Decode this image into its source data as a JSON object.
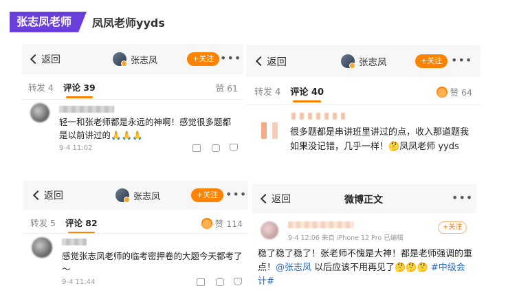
{
  "header": {
    "badge": "张志凤老师",
    "title": "凤凤老师yyds"
  },
  "common": {
    "back": "返回",
    "author": "张志凤",
    "follow": "+关注",
    "more": "•••"
  },
  "card1": {
    "reposts": "转发 4",
    "comments": "评论 39",
    "likes": "赞 61",
    "comment_text": "轻一和张老师都是永远的神啊！感觉很多题都是以前讲过的🙏🙏🙏",
    "time": "9-4 11:02"
  },
  "card2": {
    "reposts": "转发 4",
    "comments": "评论 40",
    "likes": "赞 64",
    "comment_text": "很多题都是串讲班里讲过的点，收入那道题我如果没记错，几乎一样！🤔凤凤老师 yyds"
  },
  "card3": {
    "reposts": "转发 5",
    "comments": "评论 82",
    "likes": "赞 114",
    "comment_text": "感觉张志凤老师的临考密押卷的大题今天都考了～",
    "time": "9-4 11:44"
  },
  "card4": {
    "title": "微博正文",
    "meta": "9-4 12:06 来自 iPhone 12 Pro 已编辑",
    "follow": "+关注",
    "text_a": "稳了稳了稳了！张老师不愧是大神！都是老师强调的重点！",
    "mention": "@张志凤",
    "text_b": " 以后应该不用再见了🤔🤔🤔 ",
    "hashtag": "#中级会计#"
  }
}
